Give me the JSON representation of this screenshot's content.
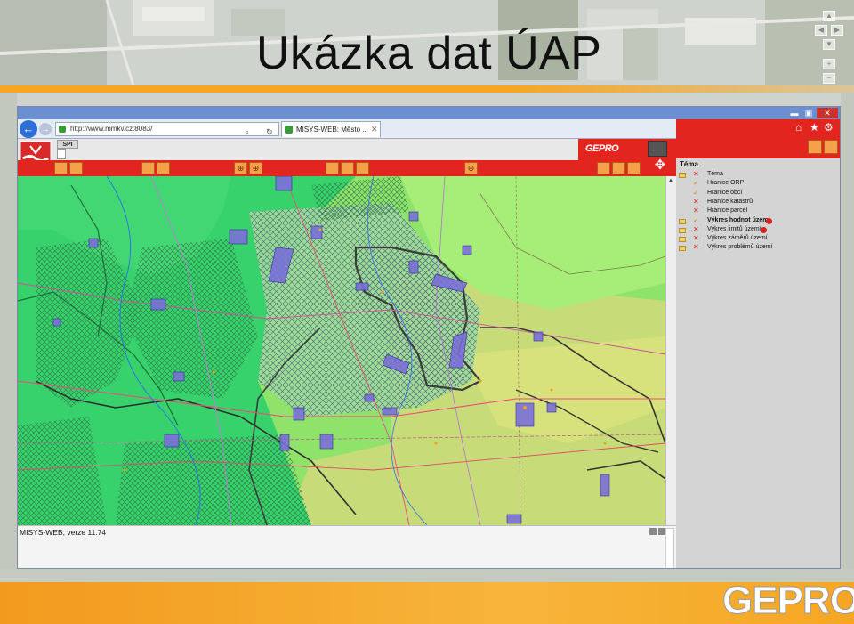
{
  "slide": {
    "title": "Ukázka dat ÚAP",
    "logo_text": "GEPRO",
    "nav": {
      "prev": "◀",
      "next": "▶",
      "up": "▲",
      "down": "▼",
      "zoom_in": "+",
      "zoom_out": "−"
    }
  },
  "browser": {
    "url": "http://www.mmkv.cz:8083/",
    "tab_title": "MISYS-WEB: Město ...",
    "window_controls": {
      "minimize": "▬",
      "maximize": "▣",
      "close": "✕"
    },
    "back": "←",
    "forward": "→",
    "tab_close": "✕",
    "addr_search": "⌕",
    "addr_refresh": "↻",
    "tools": {
      "home": "⌂",
      "favorites": "★",
      "settings": "⚙"
    }
  },
  "app": {
    "spi_tab": "SPI",
    "header_logo": "GEPRO",
    "version": "MISYS-WEB, verze 11.74",
    "toolbar_glyphs": {
      "pan": "✥",
      "zoom": "⊕"
    }
  },
  "layer_panel": {
    "header": "Téma",
    "items": [
      {
        "mark": "x",
        "folder": true,
        "name": "Téma",
        "bold": false,
        "info": false
      },
      {
        "mark": "check",
        "folder": false,
        "name": "Hranice ORP",
        "bold": false,
        "info": false
      },
      {
        "mark": "check",
        "folder": false,
        "name": "Hranice obcí",
        "bold": false,
        "info": false
      },
      {
        "mark": "x",
        "folder": false,
        "name": "Hranice katastrů",
        "bold": false,
        "info": false
      },
      {
        "mark": "x",
        "folder": false,
        "name": "Hranice parcel",
        "bold": false,
        "info": false
      },
      {
        "mark": "check",
        "folder": true,
        "name": "Výkres hodnot území",
        "bold": true,
        "info": true
      },
      {
        "mark": "x",
        "folder": true,
        "name": "Výkres limitů území",
        "bold": false,
        "info": true
      },
      {
        "mark": "x",
        "folder": true,
        "name": "Výkres záměrů území",
        "bold": false,
        "info": false
      },
      {
        "mark": "x",
        "folder": true,
        "name": "Výkres problémů území",
        "bold": false,
        "info": false
      }
    ]
  },
  "colors": {
    "accent_red": "#e3251f",
    "accent_orange": "#f6a623",
    "map_green": "#35d36a",
    "map_lightgreen": "#9be86e",
    "map_yellowgreen": "#c9df74"
  }
}
